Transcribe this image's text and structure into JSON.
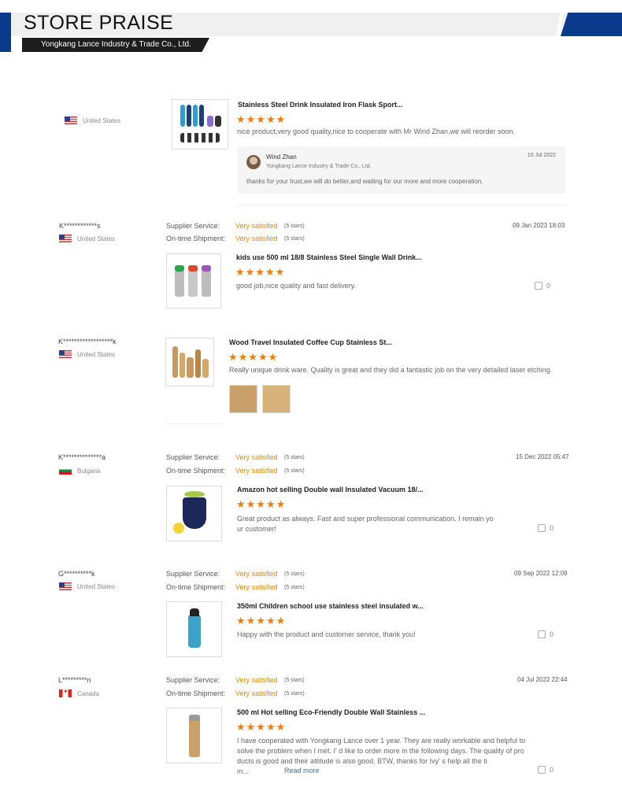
{
  "header": {
    "title": "STORE PRAISE",
    "company": "Yongkang Lance Industry & Trade Co., Ltd."
  },
  "labels": {
    "supplier_service": "Supplier Service:",
    "ontime_shipment": "On-time Shipment:",
    "read_more": "Read more"
  },
  "colors": {
    "brand_blue": "#0b3a8c",
    "star_orange": "#f07c10",
    "satisfied_orange": "#e08a0c"
  },
  "reviews": [
    {
      "country": "United States",
      "flag": "us-flag",
      "product_title": "Stainless Steel Drink Insulated Iron Flask Sport...",
      "rating": "★★★★★",
      "text": "nice product,very good quality,nice to cooperate with Mr Wind Zhan,we will reorder soon.",
      "reply": {
        "name": "Wind Zhan",
        "company": "Yongkang Lance Industry & Trade Co., Ltd.",
        "date": "10 Jul 2022",
        "text": "thanks for your trust,we will do better,and waiting for our more and more cooperation."
      }
    },
    {
      "user": "K************s",
      "country": "United States",
      "flag": "us-flag",
      "supplier_service": "Very satisfied",
      "supplier_stars": "(5 stars)",
      "shipment": "Very satisfied",
      "shipment_stars": "(5 stars)",
      "date": "09 Jan 2023 18:03",
      "product_title": "kids use 500 ml 18/8 Stainless Steel Single Wall Drink...",
      "rating": "★★★★★",
      "text": "good job,nice quality and fast delivery.",
      "likes": "0"
    },
    {
      "user": "K******************k",
      "country": "United States",
      "flag": "us-flag",
      "product_title": "Wood Travel Insulated Coffee Cup Stainless St...",
      "rating": "★★★★★",
      "text": "Really unique drink ware. Quality is great and they did a fantastic job on the very detailed laser etching."
    },
    {
      "user": "K**************a",
      "country": "Bulgaria",
      "flag": "bulgaria-flag",
      "supplier_service": "Very satisfied",
      "supplier_stars": "(5 stars)",
      "shipment": "Very satisfied",
      "shipment_stars": "(5 stars)",
      "date": "15 Dec 2022 05:47",
      "product_title": "Amazon hot selling Double wall Insulated Vacuum 18/...",
      "rating": "★★★★★",
      "text_line1": "Great product as always. Fast and super professional communication. I remain yo",
      "text_line2": "ur customer!",
      "likes": "0"
    },
    {
      "user": "G**********k",
      "country": "United States",
      "flag": "us-flag",
      "supplier_service": "Very satisfied",
      "supplier_stars": "(5 stars)",
      "shipment": "Very satisfied",
      "shipment_stars": "(5 stars)",
      "date": "09 Sep 2022 12:09",
      "product_title": "350ml Children school use stainless steel insulated w...",
      "rating": "★★★★★",
      "text": "Happy with the product and customer service, thank you!",
      "likes": "0"
    },
    {
      "user": "L*********n",
      "country": "Canada",
      "flag": "canada-flag",
      "supplier_service": "Very satisfied",
      "supplier_stars": "(5 stars)",
      "shipment": "Very satisfied",
      "shipment_stars": "(5 stars)",
      "date": "04 Jul 2022 22:44",
      "product_title": "500 ml Hot selling Eco-Friendly Double Wall Stainless ...",
      "rating": "★★★★★",
      "text_line1": "I have cooperated with Yongkang Lance over 1 year. They are really workable and helpful to",
      "text_line2": "solve the problem when I met. I' d like to order more in the following days. The quality of pro",
      "text_line3": "ducts is good and their attitude is also good. BTW, thanks for Ivy' s help all the ti",
      "text_line4": "m...",
      "likes": "0"
    }
  ]
}
